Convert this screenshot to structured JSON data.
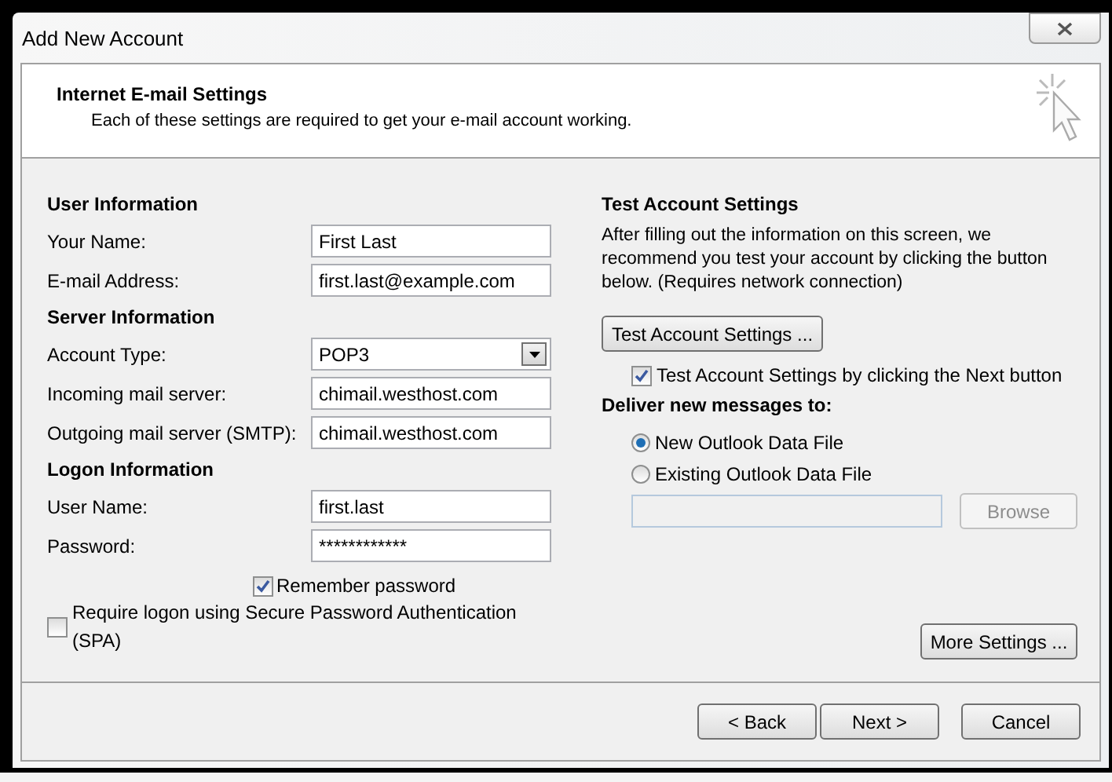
{
  "window": {
    "title": "Add New Account"
  },
  "header": {
    "title": "Internet E-mail Settings",
    "subtitle": "Each of these settings are required to get your e-mail account working."
  },
  "left": {
    "sections": [
      {
        "heading": "User Information",
        "fields": [
          {
            "kind": "text",
            "label": "Your Name:",
            "value": "First Last"
          },
          {
            "kind": "text",
            "label": "E-mail Address:",
            "value": "first.last@example.com"
          }
        ]
      },
      {
        "heading": "Server Information",
        "fields": [
          {
            "kind": "dropdown",
            "label": "Account Type:",
            "value": "POP3"
          },
          {
            "kind": "text",
            "label": "Incoming mail server:",
            "value": "chimail.westhost.com"
          },
          {
            "kind": "text",
            "label": "Outgoing mail server (SMTP):",
            "value": "chimail.westhost.com"
          }
        ]
      },
      {
        "heading": "Logon Information",
        "fields": [
          {
            "kind": "text",
            "label": "User Name:",
            "value": "first.last"
          },
          {
            "kind": "password",
            "label": "Password:",
            "value": "************"
          }
        ]
      }
    ],
    "remember": {
      "label": "Remember password",
      "checked": true
    },
    "spa": {
      "label": "Require logon using Secure Password Authentication (SPA)",
      "checked": false
    }
  },
  "right": {
    "heading": "Test Account Settings",
    "description": "After filling out the information on this screen, we recommend you test your account by clicking the button below. (Requires network connection)",
    "test_button": "Test Account Settings ...",
    "test_on_next": {
      "label": "Test Account Settings by clicking the Next button",
      "checked": true
    },
    "deliver_heading": "Deliver new messages to:",
    "options": [
      {
        "label": "New Outlook Data File",
        "selected": true
      },
      {
        "label": "Existing Outlook Data File",
        "selected": false
      }
    ],
    "data_file": {
      "disabled": true
    },
    "browse": {
      "label": "Browse",
      "disabled": true
    },
    "more_settings": "More Settings ..."
  },
  "buttons": [
    {
      "label": "< Back"
    },
    {
      "label": "Next >"
    },
    {
      "label": "Cancel"
    }
  ]
}
